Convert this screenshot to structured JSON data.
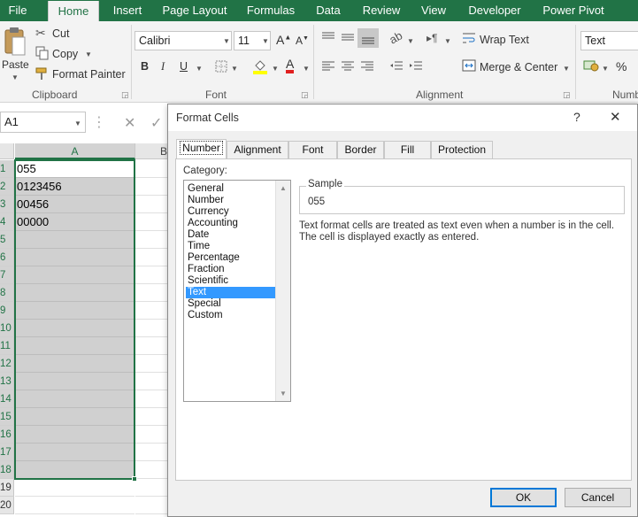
{
  "ribbon_tabs": [
    "File",
    "Home",
    "Insert",
    "Page Layout",
    "Formulas",
    "Data",
    "Review",
    "View",
    "Developer",
    "Power Pivot"
  ],
  "clipboard": {
    "paste": "Paste",
    "cut": "Cut",
    "copy": "Copy",
    "format_painter": "Format Painter",
    "group_label": "Clipboard"
  },
  "font": {
    "name": "Calibri",
    "size": "11",
    "bold": "B",
    "italic": "I",
    "underline": "U",
    "font_color": "A",
    "group_label": "Font"
  },
  "alignment": {
    "wrap_text": "Wrap Text",
    "merge_center": "Merge & Center",
    "group_label": "Alignment"
  },
  "number": {
    "format": "Text",
    "percent": "%",
    "group_label": "Numb"
  },
  "name_box": "A1",
  "columns": [
    "A",
    "B"
  ],
  "rows": [
    {
      "num": "1",
      "value": "055"
    },
    {
      "num": "2",
      "value": "0123456"
    },
    {
      "num": "3",
      "value": "00456"
    },
    {
      "num": "4",
      "value": "00000"
    },
    {
      "num": "5",
      "value": ""
    },
    {
      "num": "6",
      "value": ""
    },
    {
      "num": "7",
      "value": ""
    },
    {
      "num": "8",
      "value": ""
    },
    {
      "num": "9",
      "value": ""
    },
    {
      "num": "10",
      "value": ""
    },
    {
      "num": "11",
      "value": ""
    },
    {
      "num": "12",
      "value": ""
    },
    {
      "num": "13",
      "value": ""
    },
    {
      "num": "14",
      "value": ""
    },
    {
      "num": "15",
      "value": ""
    },
    {
      "num": "16",
      "value": ""
    },
    {
      "num": "17",
      "value": ""
    },
    {
      "num": "18",
      "value": ""
    },
    {
      "num": "19",
      "value": ""
    },
    {
      "num": "20",
      "value": ""
    }
  ],
  "dialog": {
    "title": "Format Cells",
    "help": "?",
    "close": "✕",
    "tabs": [
      "Number",
      "Alignment",
      "Font",
      "Border",
      "Fill",
      "Protection"
    ],
    "category_label": "Category:",
    "categories": [
      "General",
      "Number",
      "Currency",
      "Accounting",
      "Date",
      "Time",
      "Percentage",
      "Fraction",
      "Scientific",
      "Text",
      "Special",
      "Custom"
    ],
    "selected_category": "Text",
    "sample_label": "Sample",
    "sample_value": "055",
    "description_line1": "Text format cells are treated as text even when a number is in the cell.",
    "description_line2": "The cell is displayed exactly as entered.",
    "ok": "OK",
    "cancel": "Cancel"
  },
  "colors": {
    "excel_green": "#217346",
    "selection_blue": "#3399ff",
    "selected_cell_gray": "#d0d0d0"
  }
}
